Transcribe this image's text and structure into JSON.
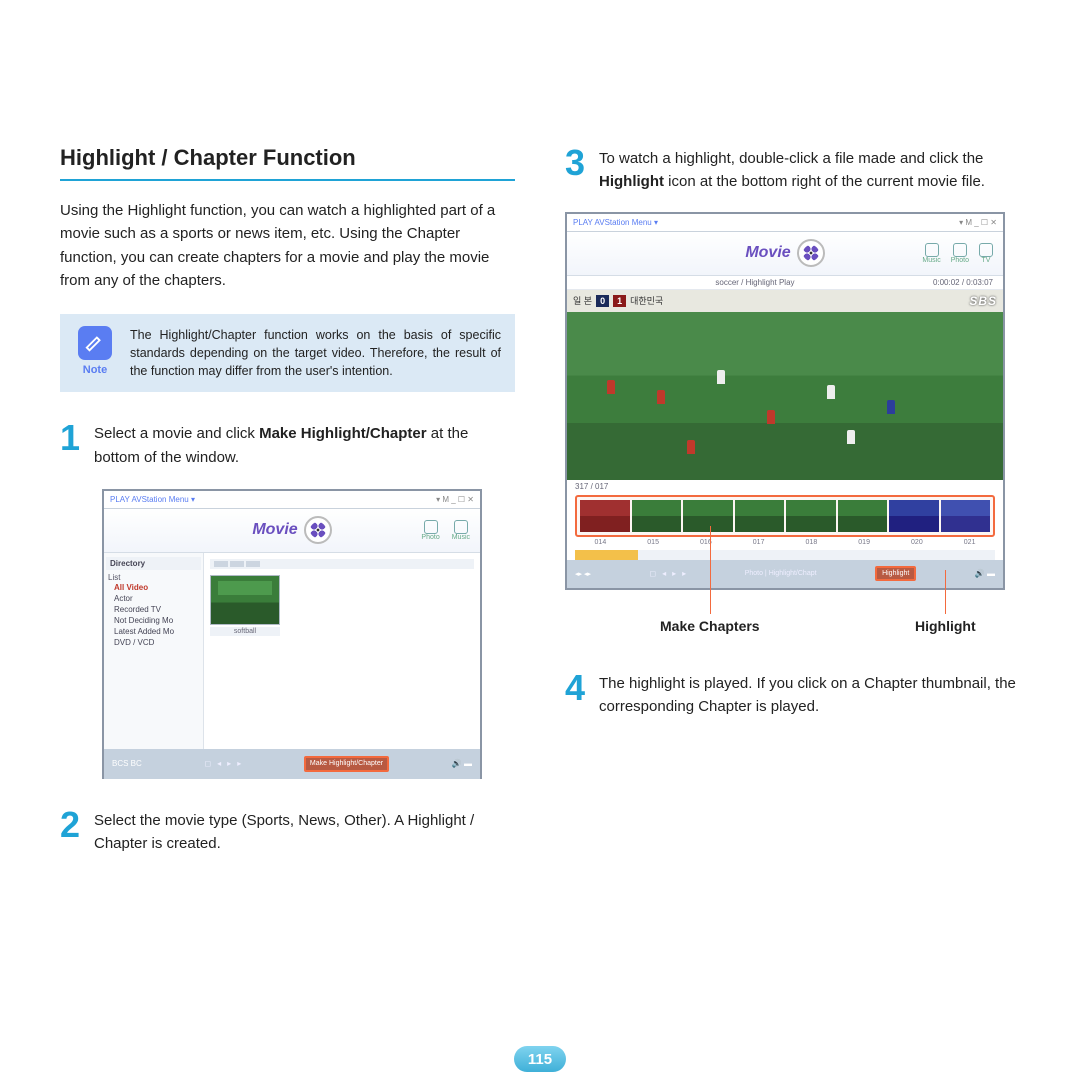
{
  "title": "Highlight / Chapter Function",
  "intro": "Using the Highlight function, you can watch a highlighted part of a movie such as a sports or news item, etc. Using the Chapter function, you can create chapters for a movie and play the movie from any of the chapters.",
  "note": {
    "label": "Note",
    "text": "The Highlight/Chapter function works on the basis of specific standards depending on the target video. Therefore, the result of the function may differ from the user's intention."
  },
  "step1_pre": "Select a movie and click ",
  "step1_bold": "Make Highlight/Chapter",
  "step1_post": " at the bottom of the window.",
  "step2": "Select the movie type (Sports, News, Other). A Highlight / Chapter is created.",
  "step3_pre": "To watch a highlight, double-click a file made and click the ",
  "step3_bold": "Highlight",
  "step3_post": " icon at the bottom right of the current movie file.",
  "step4": "The highlight is played. If you click on a Chapter thumbnail, the corresponding Chapter is played.",
  "callouts": {
    "make_chapters": "Make Chapters",
    "highlight": "Highlight"
  },
  "page_number": "115",
  "app": {
    "window_title": "PLAY AVStation  Menu ▾",
    "window_controls": "▾  M  _  ☐  ✕",
    "movie_label": "Movie",
    "nav": {
      "photo": "Photo",
      "music": "Music",
      "tv": "TV"
    },
    "sidebar_title": "Directory",
    "sidebar_items": [
      "All Video",
      "Actor",
      "Recorded TV",
      "Not Deciding Mo",
      "Latest Added Mo",
      "DVD / VCD"
    ],
    "dir_label": "List",
    "thumb_label": "softball",
    "make_hc_btn": "Make Highlight/Chapter",
    "bc_label": "BCS  BC",
    "video_info_center": "soccer / Highlight Play",
    "video_info_right": "0:00:02 / 0:03:07",
    "score": {
      "a": "0",
      "b": "1",
      "team_a": "일 본",
      "team_b": "대한민국"
    },
    "sbs": "SBS",
    "chapter_counter": "317 / 017",
    "chap_labels": [
      "014",
      "015",
      "016",
      "017",
      "018",
      "019",
      "020",
      "021"
    ],
    "highlight_btn": "Highlight",
    "photo_chapt": "Photo | Highlight/Chapt"
  }
}
